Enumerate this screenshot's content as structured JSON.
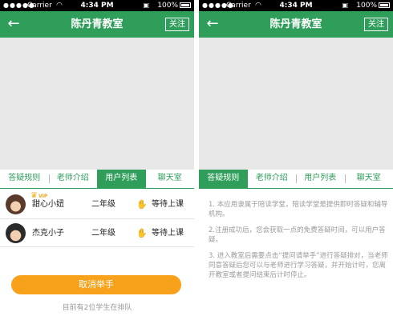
{
  "status_bar": {
    "signal": "●●●●●",
    "carrier": "Carrier",
    "wifi_icon": "wifi-icon",
    "time": "4:34 PM",
    "battery": "100%"
  },
  "nav": {
    "back_icon": "←",
    "title": "陈丹青教室",
    "follow": "关注"
  },
  "tabs": [
    "答疑规则",
    "老师介绍",
    "用户列表",
    "聊天室"
  ],
  "colors": {
    "primary": "#2f9e5b",
    "accent": "#f7a21a",
    "video_bg": "#e8e8e8"
  },
  "left_screen": {
    "active_tab": 2,
    "users": [
      {
        "name": "甜心小妞",
        "vip": "VIP",
        "crown_icon": "crown-icon",
        "grade": "二年级",
        "hand_icon": "raised-hand-icon",
        "hand_glyph": "✋",
        "status": "等待上课"
      },
      {
        "name": "杰克小子",
        "grade": "二年级",
        "hand_icon": "raised-hand-icon",
        "hand_glyph": "✋",
        "status": "等待上课"
      }
    ],
    "cancel_button": "取消举手",
    "queue_text": "目前有2位学生在排队"
  },
  "right_screen": {
    "active_tab": 0,
    "rules": [
      "1. 本应用隶属于陪读学堂，陪读学堂是提供即时答疑和辅导机构。",
      "2.注册成功后，您会获取一点的免费答疑时间，可以用户答疑。",
      "3. 进入教室后需要点击“提问请举手”进行答疑排对，当老师同意答疑后您可以与老师进行学习答疑，并开始计时，您离开教室或者提问结束后计时停止。"
    ]
  }
}
